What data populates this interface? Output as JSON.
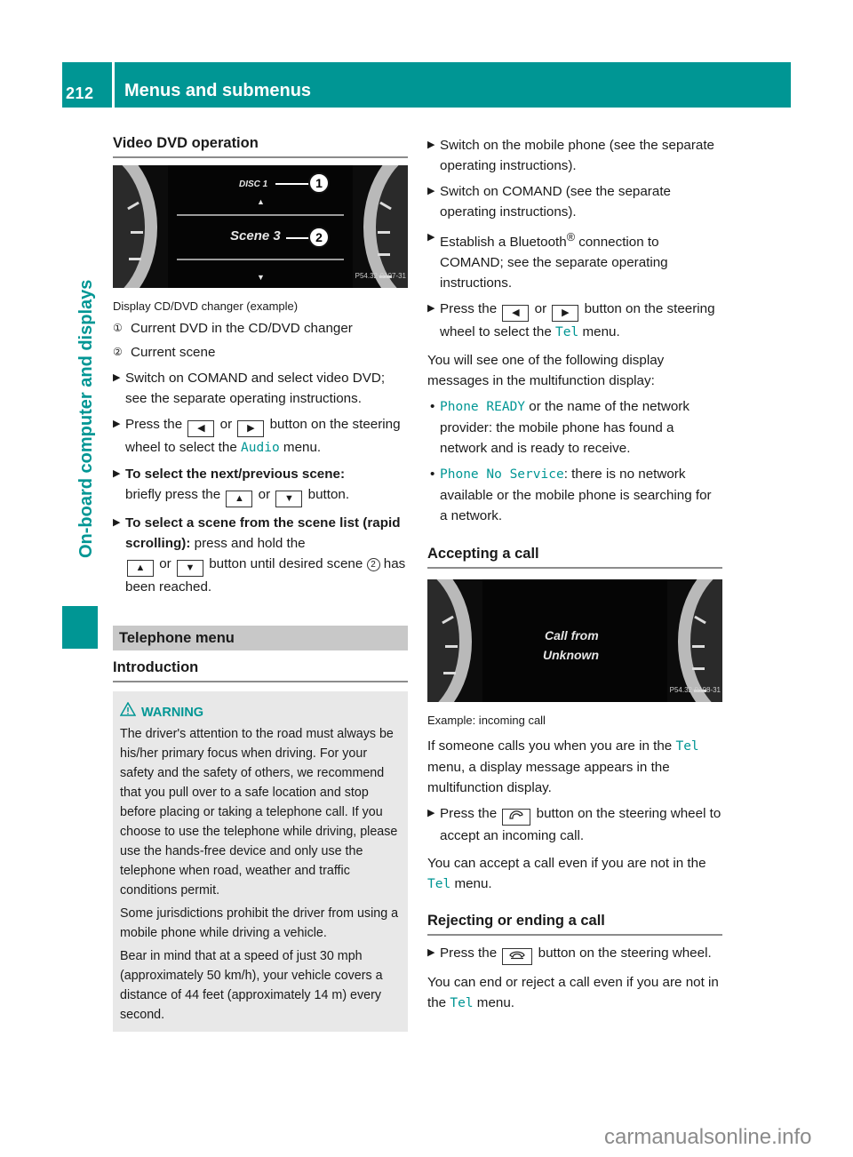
{
  "header": {
    "page_number": "212",
    "title": "Menus and submenus"
  },
  "side_tab": {
    "label": "On-board computer and displays"
  },
  "left": {
    "video_dvd": {
      "heading": "Video DVD operation",
      "figure": {
        "disc_label": "DISC 1",
        "scene_label": "Scene 3",
        "callout_1": "1",
        "callout_2": "2",
        "code": "P54.32-9107-31"
      },
      "caption": "Display CD/DVD changer (example)",
      "legend": [
        {
          "num": "①",
          "text": "Current DVD in the CD/DVD changer"
        },
        {
          "num": "②",
          "text": "Current scene"
        }
      ],
      "steps": {
        "s1": "Switch on COMAND and select video DVD; see the separate operating instructions.",
        "s2_a": "Press the",
        "s2_or": "or",
        "s2_b": "button on the steering wheel to select the",
        "s2_menu": "Audio",
        "s2_c": "menu.",
        "s3_bold": "To select the next/previous scene:",
        "s3_a": "briefly press the",
        "s3_or": "or",
        "s3_b": "button.",
        "s4_bold": "To select a scene from the scene list (rapid scrolling):",
        "s4_a": "press and hold the",
        "s4_or": "or",
        "s4_b": "button until desired scene",
        "s4_num": "2",
        "s4_c": "has been reached."
      },
      "buttons": {
        "left": "◀",
        "right": "▶",
        "up": "▲",
        "down": "▼"
      }
    },
    "telephone": {
      "bar_title": "Telephone menu",
      "intro_heading": "Introduction",
      "warning": {
        "title": "WARNING",
        "p1": "The driver's attention to the road must always be his/her primary focus when driving. For your safety and the safety of others, we recommend that you pull over to a safe location and stop before placing or taking a telephone call. If you choose to use the telephone while driving, please use the hands-free device and only use the telephone when road, weather and traffic conditions permit.",
        "p2": "Some jurisdictions prohibit the driver from using a mobile phone while driving a vehicle.",
        "p3": "Bear in mind that at a speed of just 30 mph (approximately 50 km/h), your vehicle covers a distance of 44 feet (approximately 14 m) every second."
      }
    }
  },
  "right": {
    "steps": {
      "r1": "Switch on the mobile phone (see the separate operating instructions).",
      "r2": "Switch on COMAND (see the separate operating instructions).",
      "r3_a": "Establish a Bluetooth",
      "r3_reg": "®",
      "r3_b": " connection to COMAND; see the separate operating instructions.",
      "r4_a": "Press the",
      "r4_or": "or",
      "r4_b": "button on the steering wheel to select the",
      "r4_menu": "Tel",
      "r4_c": "menu."
    },
    "display_intro": "You will see one of the following display messages in the multifunction display:",
    "bullets": [
      {
        "code": "Phone READY",
        "text": " or the name of the network provider: the mobile phone has found a network and is ready to receive."
      },
      {
        "code": "Phone No Service",
        "text": ": there is no network available or the mobile phone is searching for a network."
      }
    ],
    "accepting": {
      "heading": "Accepting a call",
      "figure": {
        "line1": "Call from",
        "line2": "Unknown",
        "code": "P54.32-9108-31"
      },
      "caption": "Example: incoming call",
      "p1_a": "If someone calls you when you are in the",
      "p1_menu": "Tel",
      "p1_b": "menu, a display message appears in the multifunction display.",
      "step_a": "Press the",
      "step_b": "button on the steering wheel to accept an incoming call.",
      "p2_a": "You can accept a call even if you are not in the",
      "p2_menu": "Tel",
      "p2_b": "menu."
    },
    "rejecting": {
      "heading": "Rejecting or ending a call",
      "step_a": "Press the",
      "step_b": "button on the steering wheel.",
      "p_a": "You can end or reject a call even if you are not in the",
      "p_menu": "Tel",
      "p_b": "menu."
    }
  },
  "watermark": "carmanualsonline.info",
  "colors": {
    "accent": "#009694",
    "grey_bar": "#c8c8c8",
    "warning_bg": "#e8e8e8"
  }
}
